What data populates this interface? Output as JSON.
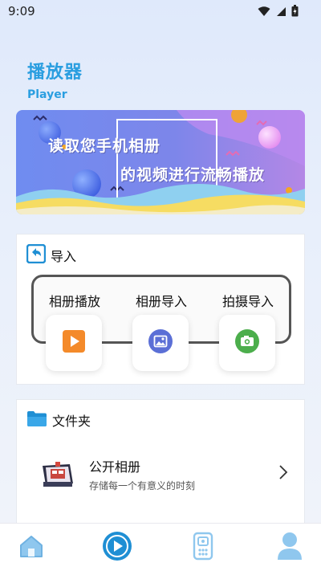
{
  "status_bar": {
    "time": "9:09"
  },
  "header": {
    "title": "播放器",
    "subtitle": "Player"
  },
  "banner": {
    "line1": "读取您手机相册",
    "line2": "的视频进行流畅播放"
  },
  "import_section": {
    "title": "导入",
    "options": [
      {
        "label": "相册播放",
        "icon": "play-icon",
        "color": "#f48a2a"
      },
      {
        "label": "相册导入",
        "icon": "image-icon",
        "color": "#5b6fd6"
      },
      {
        "label": "拍摄导入",
        "icon": "camera-icon",
        "color": "#4cae4c"
      }
    ]
  },
  "folder_section": {
    "title": "文件夹",
    "album": {
      "title": "公开相册",
      "desc": "存储每一个有意义的时刻"
    }
  },
  "bottom_nav": {
    "items": [
      {
        "icon": "home-icon"
      },
      {
        "icon": "play-circle-icon"
      },
      {
        "icon": "remote-icon"
      },
      {
        "icon": "user-icon"
      }
    ]
  },
  "colors": {
    "accent": "#2a9ee0"
  }
}
